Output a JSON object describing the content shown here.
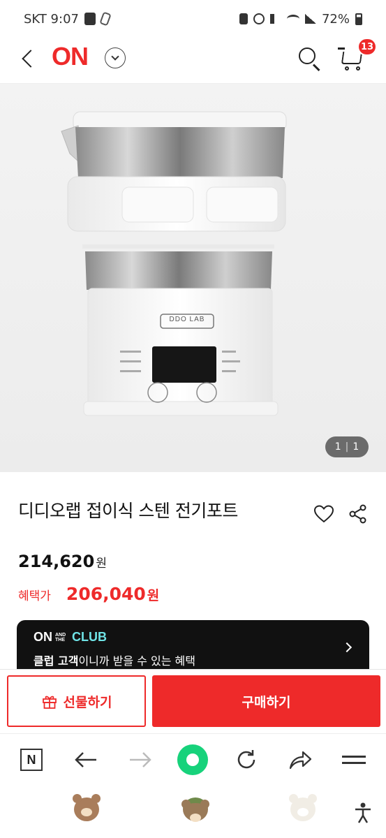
{
  "status_bar": {
    "carrier_time": "SKT 9:07",
    "battery": "72%"
  },
  "header": {
    "logo": "ON",
    "cart_count": "13"
  },
  "gallery": {
    "counter_current": "1",
    "counter_separator": "|",
    "counter_total": "1",
    "product_brand_print": "DDO LAB"
  },
  "product": {
    "title": "디디오랩 접이식 스텐 전기포트",
    "price": "214,620",
    "currency": "원",
    "benefit_label": "혜택가",
    "benefit_price": "206,040",
    "benefit_currency": "원"
  },
  "club_banner": {
    "logo_on": "ON",
    "logo_andthe_1": "AND",
    "logo_andthe_2": "THE",
    "logo_club": "CLUB",
    "text_bold": "클럽 고객",
    "text_rest": "이니까 받을 수 있는 혜택"
  },
  "actions": {
    "gift_label": "선물하기",
    "buy_label": "구매하기"
  },
  "browser_bar": {
    "n_label": "N"
  },
  "colors": {
    "brand_red": "#ee2a2a",
    "club_cyan": "#6fe3e6",
    "home_green": "#17d27b"
  }
}
